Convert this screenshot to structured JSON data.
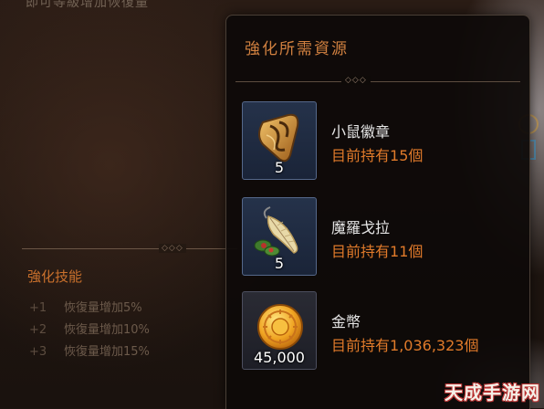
{
  "background": {
    "partial_text": "即可等級增加恢復量"
  },
  "skills": {
    "title": "強化技能",
    "items": [
      {
        "level": "+1",
        "desc": "恢復量增加5%"
      },
      {
        "level": "+2",
        "desc": "恢復量增加10%"
      },
      {
        "level": "+3",
        "desc": "恢復量增加15%"
      }
    ]
  },
  "panel": {
    "title": "強化所需資源",
    "items": [
      {
        "icon": "badge-icon",
        "qty": "5",
        "name": "小鼠徽章",
        "owned_prefix": "目前持有",
        "owned_count": "15",
        "owned_suffix": "個"
      },
      {
        "icon": "feather-herb-icon",
        "qty": "5",
        "name": "魔羅戈拉",
        "owned_prefix": "目前持有",
        "owned_count": "11",
        "owned_suffix": "個"
      },
      {
        "icon": "gold-coin-icon",
        "qty": "45,000",
        "name": "金幣",
        "owned_prefix": "目前持有",
        "owned_count": "1,036,323",
        "owned_suffix": "個"
      }
    ]
  },
  "watermark": {
    "text": "天成手游网"
  },
  "colors": {
    "accent_orange": "#e07a2a",
    "title_orange": "#d28140",
    "icon_frame": "#55688a"
  }
}
